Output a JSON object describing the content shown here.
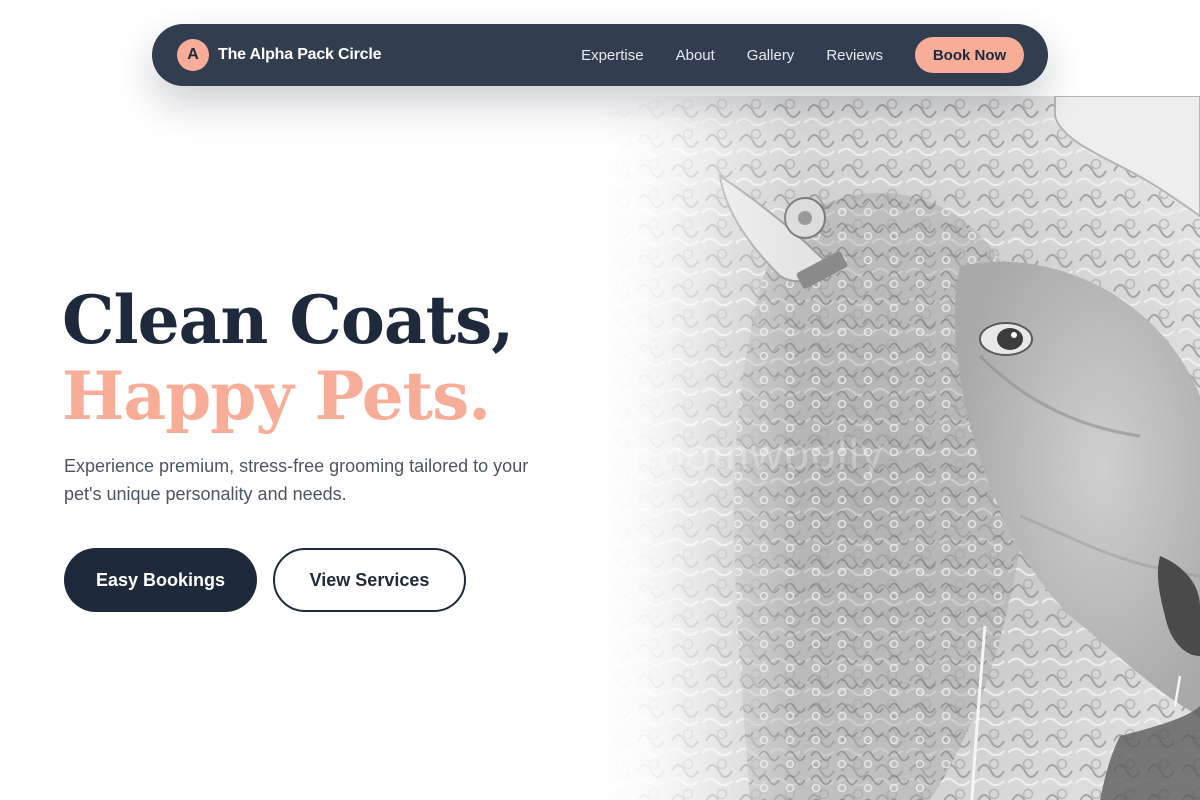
{
  "brand": {
    "logo_letter": "A",
    "name": "The Alpha Pack Circle"
  },
  "nav": {
    "links": [
      "Expertise",
      "About",
      "Gallery",
      "Reviews"
    ],
    "cta_label": "Book Now"
  },
  "hero": {
    "headline_line1": "Clean Coats,",
    "headline_line2": "Happy Pets.",
    "subtext": "Experience premium, stress-free grooming tailored to your pet's unique personality and needs.",
    "primary_button": "Easy Bookings",
    "secondary_button": "View Services",
    "image_watermark": "groomwoolly"
  },
  "colors": {
    "navy": "#1e293b",
    "nav_background": "#323d4f",
    "accent_peach": "#f7ad98",
    "body_text": "#4b5563"
  }
}
